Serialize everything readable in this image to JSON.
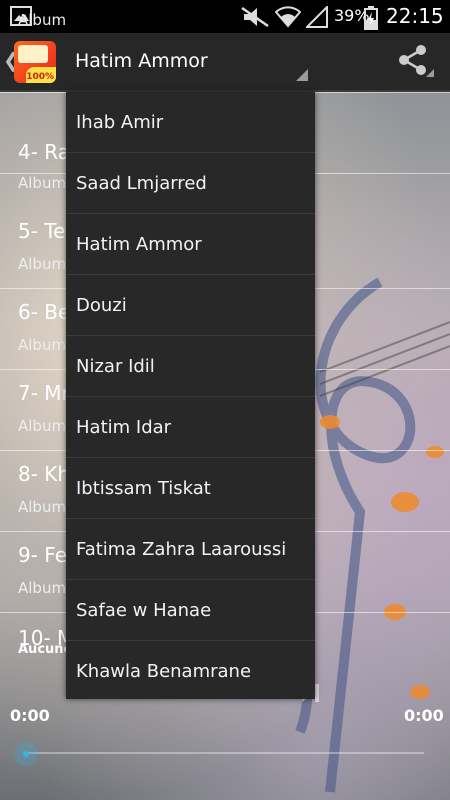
{
  "status_bar": {
    "battery_percent": "39%",
    "time": "22:15",
    "icons": [
      "image-icon",
      "mute-icon",
      "wifi-icon",
      "signal-icon",
      "battery-charging-icon"
    ]
  },
  "action_bar": {
    "app_icon_text": "100%",
    "selected_artist": "Hatim Ammor",
    "icons": [
      "back-chevron-icon",
      "app-icon",
      "share-icon"
    ]
  },
  "song_list": {
    "top_partial_subtitle": "Album",
    "rows": [
      {
        "title": "4- Ra",
        "subtitle": "Album"
      },
      {
        "title": "5- Te",
        "subtitle": "Album"
      },
      {
        "title": "6- Be",
        "subtitle": "Album"
      },
      {
        "title": "7- Mr",
        "subtitle": "Album"
      },
      {
        "title": "8- Kh",
        "subtitle": "Album"
      },
      {
        "title": "9- Fe",
        "subtitle": "Album"
      }
    ]
  },
  "player": {
    "song_name_partial": "10- M",
    "artist_partial": "Aucune",
    "elapsed": "0:00",
    "duration": "0:00",
    "progress": 0
  },
  "dropdown": {
    "items": [
      "Ihab Amir",
      "Saad Lmjarred",
      "Hatim Ammor",
      "Douzi",
      "Nizar Idil",
      "Hatim Idar",
      "Ibtissam Tiskat",
      "Fatima Zahra Laaroussi",
      "Safae w Hanae",
      "Khawla Benamrane"
    ]
  }
}
